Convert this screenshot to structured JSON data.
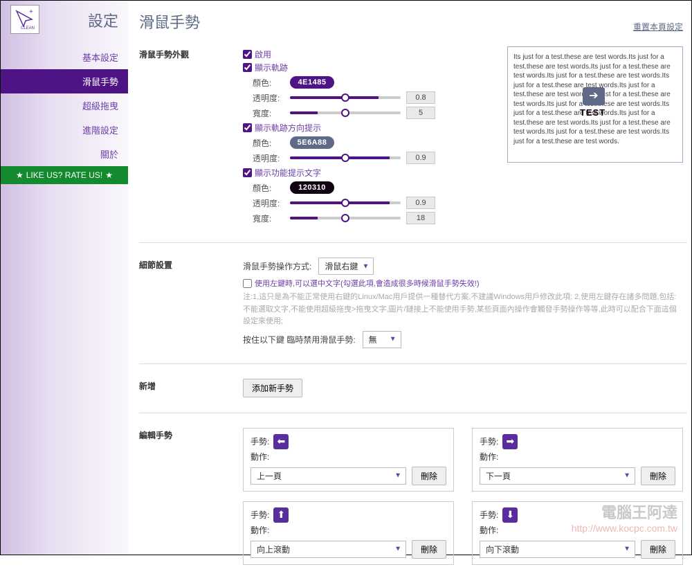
{
  "sidebar": {
    "title": "設定",
    "items": [
      {
        "label": "基本設定"
      },
      {
        "label": "滑鼠手勢"
      },
      {
        "label": "超級拖曳"
      },
      {
        "label": "進階設定"
      },
      {
        "label": "關於"
      }
    ],
    "rate": "LIKE US? RATE US!"
  },
  "header": {
    "title": "滑鼠手勢",
    "reset": "重置本頁設定"
  },
  "appearance": {
    "section_label": "滑鼠手勢外觀",
    "enable": "啟用",
    "show_trail": "顯示軌跡",
    "trail": {
      "color_label": "顏色:",
      "color": "4E1485",
      "opacity_label": "透明度:",
      "opacity": "0.8",
      "width_label": "寬度:",
      "width": "5"
    },
    "show_dir": "顯示軌跡方向提示",
    "dir": {
      "color_label": "顏色:",
      "color": "5E6A88",
      "opacity_label": "透明度:",
      "opacity": "0.9"
    },
    "show_hint": "顯示功能提示文字",
    "hint": {
      "color_label": "顏色:",
      "color": "120310",
      "opacity_label": "透明度:",
      "opacity": "0.9",
      "width_label": "寬度:",
      "width": "18"
    },
    "preview_text": "Its just for a test.these are test words.Its just for a test.these are test words.Its just for a test.these are test words.Its just for a test.these are test words.Its just for a test.these are test words.Its just for a test.these are test words.Its just for a test.these are test words.Its just for a test.these are test words.Its just for a test.these are test words.Its just for a test.these are test words.Its just for a test.these are test words.Its just for a test.these are test words.Its just for a test.these are test words.",
    "preview_badge": "TEST"
  },
  "details": {
    "section_label": "細節設置",
    "method_label": "滑鼠手勢操作方式:",
    "method_value": "滑鼠右鍵",
    "left_select": "使用左鍵時,可以選中文字(勾選此項,會造成很多時候滑鼠手勢失效!)",
    "note": "注:1,這只是為不能正常使用右鍵的Linux/Mac用戶提供一種替代方案,不建議Windows用戶修改此項; 2,使用左鍵存在諸多問題,包括:不能選取文字,不能使用超級拖曳>拖曳文字,圖片/鏈接上不能使用手勢,某些頁面內操作會觸發手勢操作等等,此時可以配合下面這個設定來使用;",
    "hold_label": "按住以下鍵 臨時禁用滑鼠手勢:",
    "hold_value": "無"
  },
  "add": {
    "section_label": "新增",
    "button": "添加新手勢"
  },
  "edit": {
    "section_label": "編輯手勢",
    "gesture_label": "手勢:",
    "action_label": "動作:",
    "delete": "刪除",
    "cards": [
      {
        "dir": "left",
        "action": "上一頁"
      },
      {
        "dir": "right",
        "action": "下一頁"
      },
      {
        "dir": "up",
        "action": "向上滾動"
      },
      {
        "dir": "down",
        "action": "向下滾動"
      }
    ]
  },
  "watermark": {
    "line1": "電腦王阿達",
    "line2": "http://www.kocpc.com.tw"
  }
}
